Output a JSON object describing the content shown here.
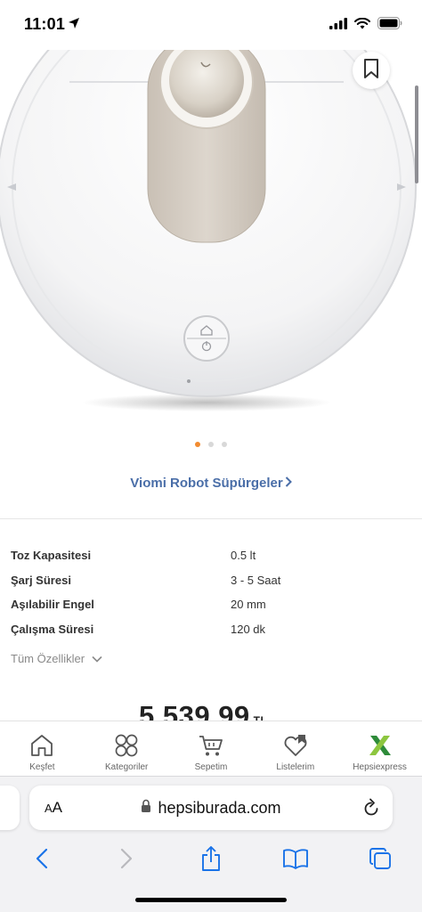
{
  "status_bar": {
    "time": "11:01"
  },
  "product": {
    "image_dots_total": 3,
    "image_dot_active": 1,
    "brand_link": "Viomi Robot Süpürgeler",
    "specs": [
      {
        "label": "Toz Kapasitesi",
        "value": "0.5 lt"
      },
      {
        "label": "Şarj Süresi",
        "value": "3 - 5 Saat"
      },
      {
        "label": "Aşılabilir Engel",
        "value": "20 mm"
      },
      {
        "label": "Çalışma Süresi",
        "value": "120 dk"
      }
    ],
    "all_features": "Tüm Özellikler",
    "price": "5.539,99",
    "currency": "TL"
  },
  "tab_bar": {
    "items": [
      {
        "label": "Keşfet",
        "icon": "home-icon"
      },
      {
        "label": "Kategoriler",
        "icon": "categories-icon"
      },
      {
        "label": "Sepetim",
        "icon": "cart-icon"
      },
      {
        "label": "Listelerim",
        "icon": "heart-list-icon"
      },
      {
        "label": "Hepsiexpress",
        "icon": "hepsiexpress-logo-icon"
      }
    ]
  },
  "browser": {
    "aa_label": "AA",
    "url": "hepsiburada.com"
  },
  "colors": {
    "accent_orange": "#f28b30",
    "link_blue": "#4a6ea8",
    "ios_blue": "#1a73e8",
    "hepsiexpress_green": "#8dc63f"
  }
}
